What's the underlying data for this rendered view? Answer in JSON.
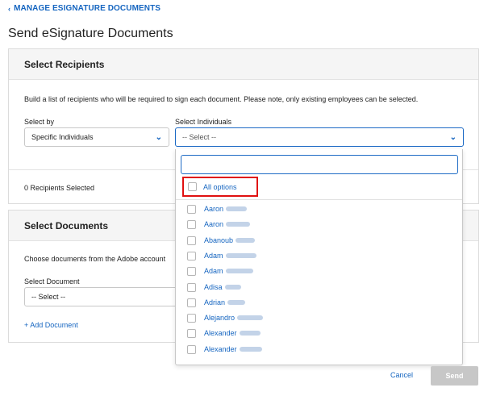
{
  "nav": {
    "back_label": "MANAGE ESIGNATURE DOCUMENTS"
  },
  "page": {
    "title": "Send eSignature Documents"
  },
  "recipients_card": {
    "title": "Select Recipients",
    "description": "Build a list of recipients who will be required to sign each document. Please note, only existing employees can be selected.",
    "select_by_label": "Select by",
    "select_by_value": "Specific Individuals",
    "select_individuals_label": "Select Individuals",
    "select_individuals_placeholder": "-- Select --",
    "count_text": "0 Recipients Selected"
  },
  "documents_card": {
    "title": "Select Documents",
    "description": "Choose documents from the Adobe account",
    "select_document_label": "Select Document",
    "select_document_placeholder": "-- Select --",
    "add_document_label": "+ Add Document"
  },
  "dropdown": {
    "search_value": "",
    "all_options_label": "All options",
    "people": [
      {
        "first": "Aaron"
      },
      {
        "first": "Aaron"
      },
      {
        "first": "Abanoub"
      },
      {
        "first": "Adam"
      },
      {
        "first": "Adam"
      },
      {
        "first": "Adisa"
      },
      {
        "first": "Adrian"
      },
      {
        "first": "Alejandro"
      },
      {
        "first": "Alexander"
      },
      {
        "first": "Alexander"
      }
    ]
  },
  "footer": {
    "cancel_label": "Cancel",
    "send_label": "Send"
  },
  "colors": {
    "link": "#1565c0",
    "highlight": "#e01010",
    "disabled": "#c7c7c7"
  },
  "icons": {
    "back": "chevron-left-icon",
    "select_arrow": "chevron-down-icon"
  }
}
